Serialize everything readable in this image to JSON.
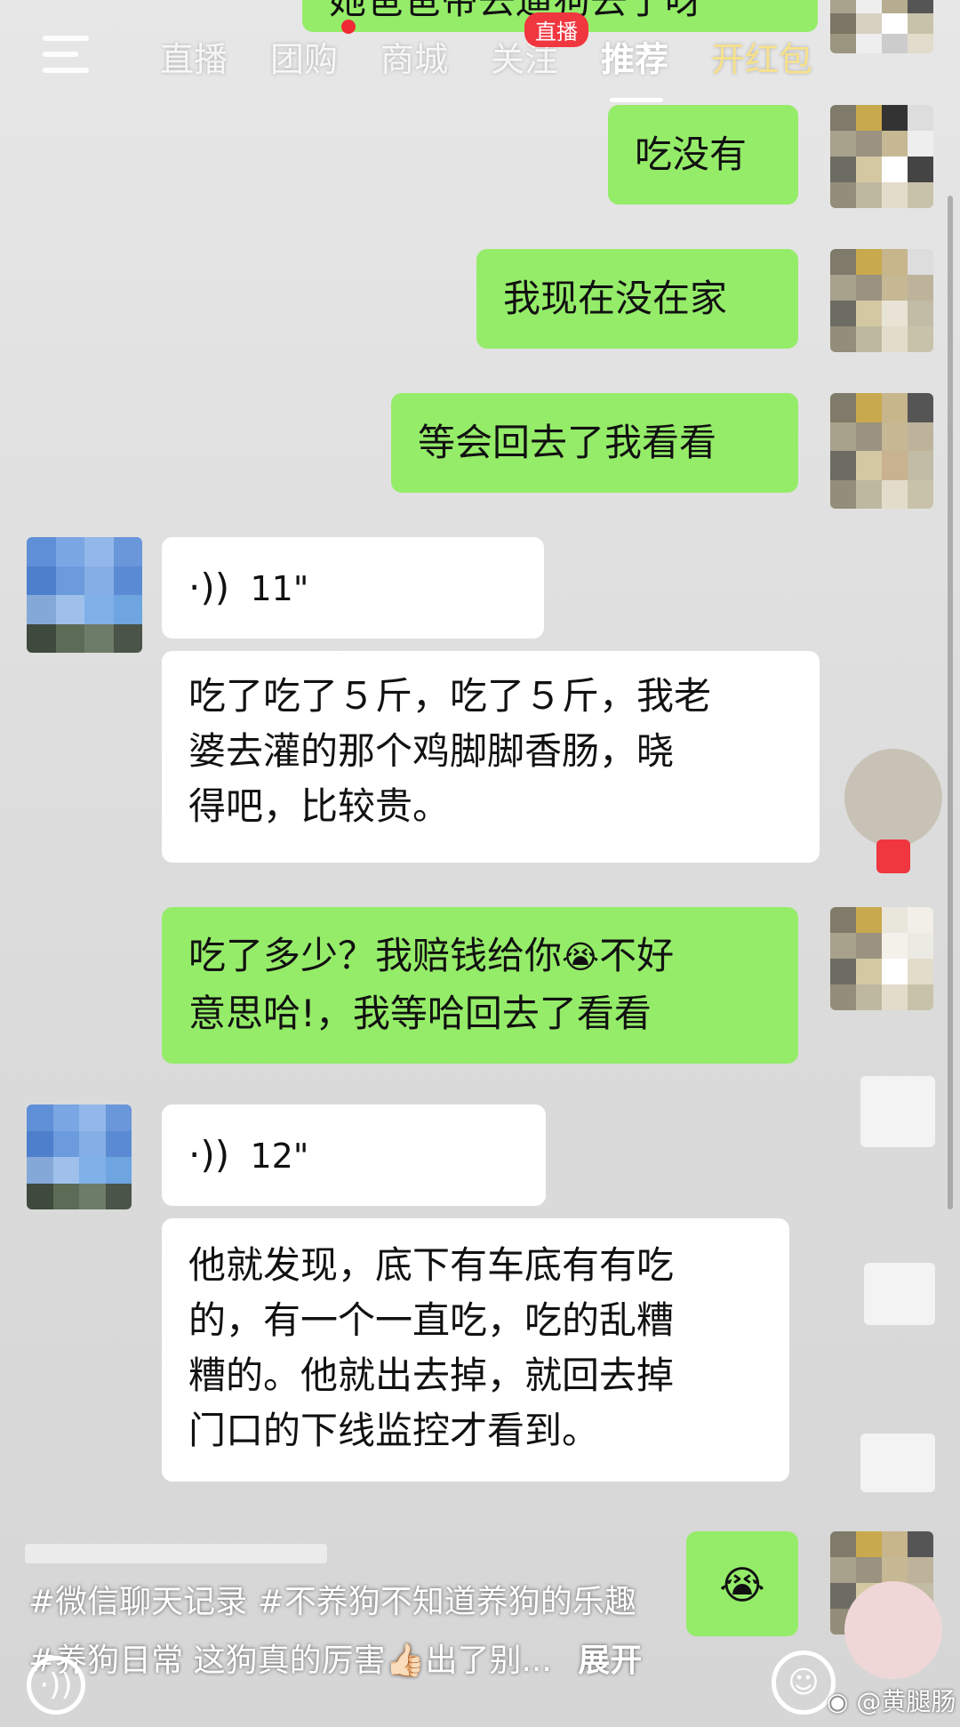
{
  "top_nav": {
    "tabs": [
      "直播",
      "团购",
      "商城",
      "关注",
      "推荐",
      "开红包"
    ],
    "live_badge": "直播"
  },
  "chat": {
    "partial_top_message": "她爸爸带去遛狗去了呀",
    "messages": [
      {
        "side": "right",
        "type": "text",
        "text": "吃没有"
      },
      {
        "side": "right",
        "type": "text",
        "text": "我现在没在家"
      },
      {
        "side": "right",
        "type": "text",
        "text": "等会回去了我看看"
      },
      {
        "side": "left",
        "type": "voice",
        "duration": "11\""
      },
      {
        "side": "left",
        "type": "text",
        "lines": [
          "吃了吃了５斤，吃了５斤，我老",
          "婆去灌的那个鸡脚脚香肠，晓",
          "得吧，比较贵。"
        ]
      },
      {
        "side": "right",
        "type": "text",
        "lines": [
          "吃了多少？我赔钱给你",
          "不好",
          "意思哈!，我等哈回去了看看"
        ],
        "emoji": "😭"
      },
      {
        "side": "left",
        "type": "voice",
        "duration": "12\""
      },
      {
        "side": "left",
        "type": "text",
        "lines": [
          "他就发现，底下有车底有有吃",
          "的，有一个一直吃，吃的乱糟",
          "糟的。他就出去掉，就回去掉",
          "门口的下线监控才看到。"
        ]
      },
      {
        "side": "right",
        "type": "emoji",
        "emoji": "😭"
      }
    ]
  },
  "caption": {
    "line1": "#微信聊天记录 #不养狗不知道养狗的乐趣",
    "line2_prefix": "#养狗日常 这狗真的厉害",
    "thumbs_emoji": "👍🏻",
    "line2_suffix": "出了别...",
    "expand": "展开"
  },
  "watermark": "@黄腿肠",
  "colors": {
    "green_bubble": "#95ec69",
    "white_bubble": "#ffffff",
    "live_red": "#f0363f"
  }
}
